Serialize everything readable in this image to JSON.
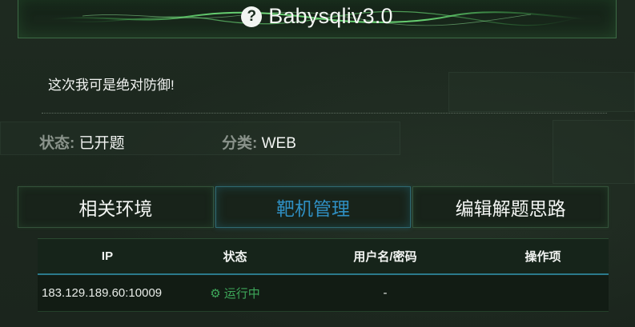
{
  "header": {
    "icon": "question-circle-icon",
    "title": "Babysqliv3.0"
  },
  "challenge": {
    "description": "这次我可是绝对防御!",
    "status_label": "状态:",
    "status_value": "已开题",
    "category_label": "分类:",
    "category_value": "WEB"
  },
  "tabs": [
    {
      "label": "相关环境",
      "active": false
    },
    {
      "label": "靶机管理",
      "active": true
    },
    {
      "label": "编辑解题思路",
      "active": false
    }
  ],
  "table": {
    "headers": [
      "IP",
      "状态",
      "用户名/密码",
      "操作项"
    ],
    "rows": [
      {
        "ip": "183.129.189.60:10009",
        "status": "运行中",
        "status_icon": "gear-icon",
        "credentials": "-",
        "actions": ""
      }
    ]
  },
  "colors": {
    "background": "#1d281f",
    "active_tab": "#2f8fc2",
    "running_status": "#3ea85a"
  }
}
